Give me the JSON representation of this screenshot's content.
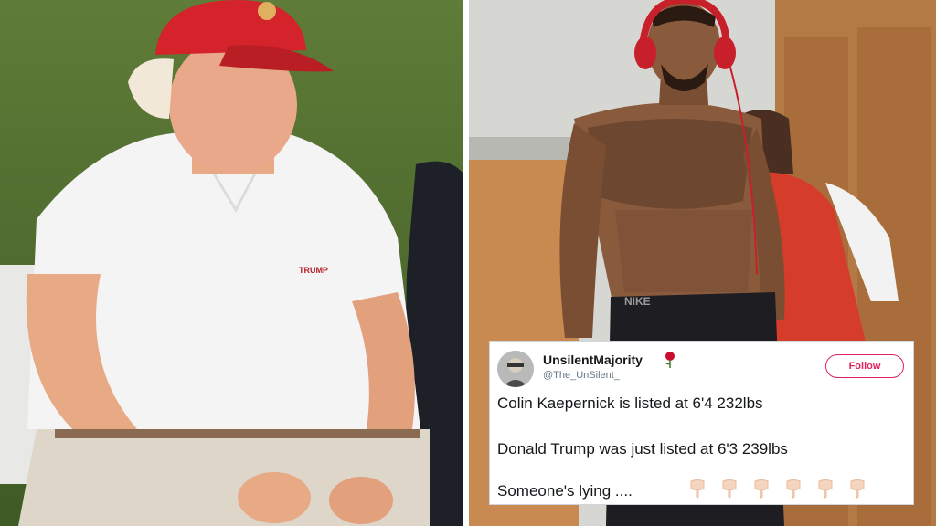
{
  "image": {
    "left_panel": {
      "subject": "man in red cap and white polo",
      "cap_color": "#d4232b",
      "shirt_color": "#f4f4f4",
      "shirt_logo": "TRUMP",
      "background_color": "#4a6a2e"
    },
    "right_panel": {
      "subject": "tattooed athlete with red headphones in locker room",
      "headphones_color": "#c8202a",
      "background_color": "#d9d9d6",
      "shorts_text": "NIKE"
    }
  },
  "tweet": {
    "display_name": "UnsilentMajority",
    "handle": "@The_UnSilent_",
    "follow_label": "Follow",
    "lines": [
      "Colin Kaepernick is listed at 6'4 232lbs",
      "Donald Trump was just listed at 6'3 239lbs",
      "Someone's lying ...."
    ],
    "emoji_icon": "point-down-icon",
    "emoji_count": 6,
    "accent_color": "#e0245e"
  }
}
